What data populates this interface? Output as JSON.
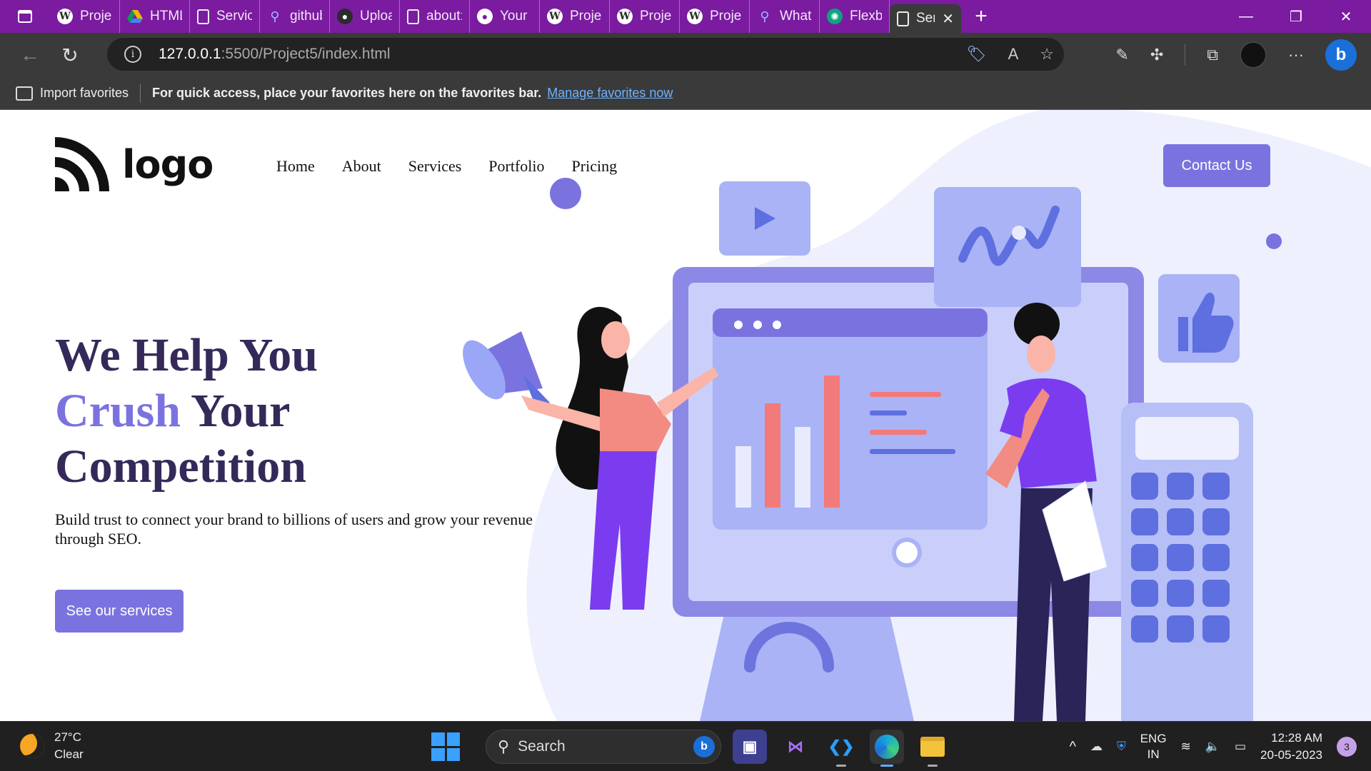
{
  "browser": {
    "tabs": [
      {
        "title": "Project",
        "icon": "wordpress-icon"
      },
      {
        "title": "HTML &",
        "icon": "google-drive-icon"
      },
      {
        "title": "Services",
        "icon": "document-icon"
      },
      {
        "title": "github -",
        "icon": "search-icon"
      },
      {
        "title": "Upload",
        "icon": "github-icon"
      },
      {
        "title": "about:b",
        "icon": "document-icon"
      },
      {
        "title": "Your Re",
        "icon": "github-icon"
      },
      {
        "title": "Project",
        "icon": "wordpress-icon"
      },
      {
        "title": "Project",
        "icon": "wordpress-icon"
      },
      {
        "title": "Project",
        "icon": "wordpress-icon"
      },
      {
        "title": "What d",
        "icon": "search-icon"
      },
      {
        "title": "Flexbox",
        "icon": "chatgpt-icon"
      },
      {
        "title": "Ser",
        "icon": "document-icon",
        "active": true
      }
    ],
    "address": {
      "host": "127.0.0.1",
      "path": ":5500/Project5/index.html"
    },
    "favorites": {
      "import_label": "Import favorites",
      "prompt": "For quick access, place your favorites here on the favorites bar.",
      "link": "Manage favorites now"
    },
    "colors": {
      "tabstrip": "#7a1ba0",
      "toolbar": "#3a3a3a"
    }
  },
  "page": {
    "logo_text": "logo",
    "nav": [
      "Home",
      "About",
      "Services",
      "Portfolio",
      "Pricing"
    ],
    "contact_label": "Contact Us",
    "hero": {
      "line1": "We Help You",
      "accent": "Crush",
      "line2_rest": " Your",
      "line3": "Competition",
      "subtitle": "Build trust to connect your brand to billions of users and grow your revenue through SEO.",
      "cta": "See our services"
    },
    "colors": {
      "accent": "#7a73df",
      "heading": "#35295a",
      "coral": "#f27a7a",
      "soft_blue": "#eef1fd"
    }
  },
  "taskbar": {
    "weather": {
      "temp": "27°C",
      "condition": "Clear"
    },
    "search_label": "Search",
    "apps": [
      "windows-start-icon",
      "teams-icon",
      "visual-studio-icon",
      "vscode-icon",
      "edge-icon",
      "file-explorer-icon"
    ],
    "tray": {
      "lang1": "ENG",
      "lang2": "IN",
      "time": "12:28 AM",
      "date": "20-05-2023",
      "notifications": "3"
    }
  }
}
